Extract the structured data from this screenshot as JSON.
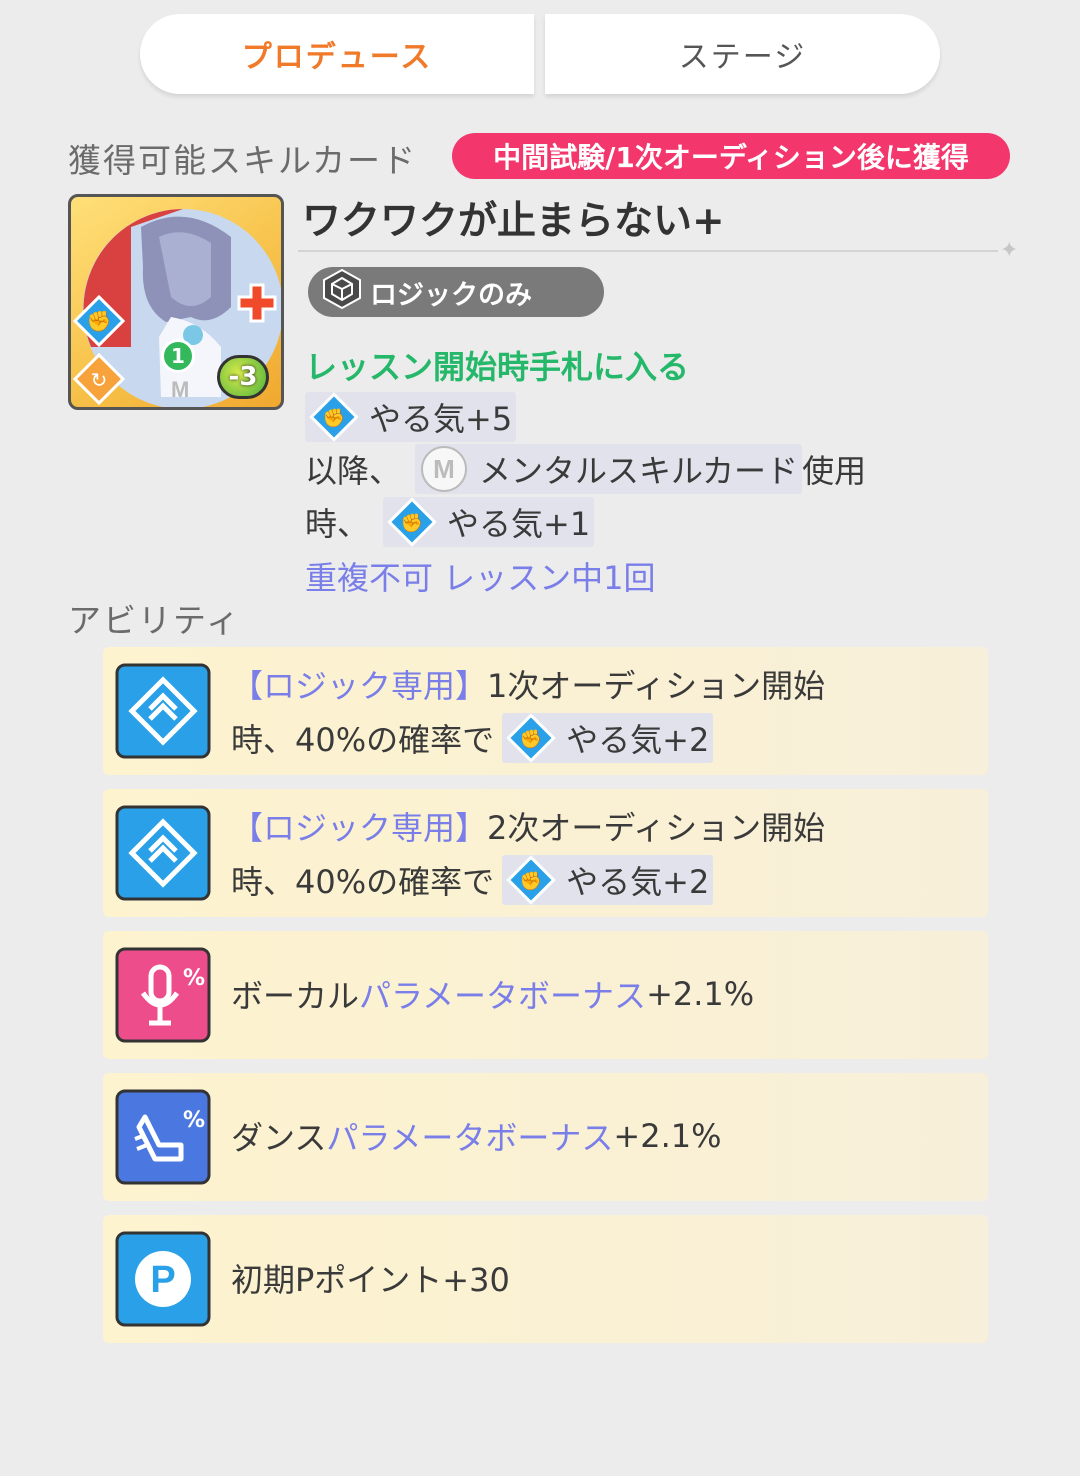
{
  "tabs": {
    "produce": "プロデュース",
    "stage": "ステージ"
  },
  "skill_section": {
    "title": "獲得可能スキルカード",
    "timing": "中間試験/1次オーディション後に獲得"
  },
  "card": {
    "name": "ワクワクが止まらない+",
    "type_chip": "ロジックのみ",
    "cost": "-3",
    "count": "1",
    "effect_intro": "レッスン開始時手札に入る",
    "effect1": "やる気+5",
    "effect2_prefix": "以降、",
    "effect2_target": "メンタルスキルカード",
    "effect2_suffix": "使用",
    "effect3_prefix": "時、",
    "effect3": "やる気+1",
    "limit": "重複不可 レッスン中1回"
  },
  "ability_section": {
    "title": "アビリティ",
    "items": [
      {
        "tag": "【ロジック専用】",
        "line1": "1次オーディション開始",
        "line2_prefix": "時、40%の確率で",
        "effect": "やる気+2"
      },
      {
        "tag": "【ロジック専用】",
        "line1": "2次オーディション開始",
        "line2_prefix": "時、40%の確率で",
        "effect": "やる気+2"
      },
      {
        "prefix": "ボーカル",
        "highlight": "パラメータボーナス",
        "value": "+2.1%"
      },
      {
        "prefix": "ダンス",
        "highlight": "パラメータボーナス",
        "value": "+2.1%"
      },
      {
        "prefix": "初期Pポイント+30"
      }
    ]
  },
  "colors": {
    "accent_orange": "#f07a2a",
    "badge_pink": "#f3366c",
    "effect_green": "#26b86a",
    "limit_purple": "#7a7ee8",
    "logic_blue": "#2aa0e8",
    "vocal_pink": "#ee4d8c",
    "dance_blue": "#4a78e0"
  },
  "icons": [
    "motivation-icon",
    "mental-m-icon",
    "logic-cube-icon",
    "ability-logic-icon",
    "vocal-mic-icon",
    "dance-icon",
    "p-point-icon"
  ]
}
